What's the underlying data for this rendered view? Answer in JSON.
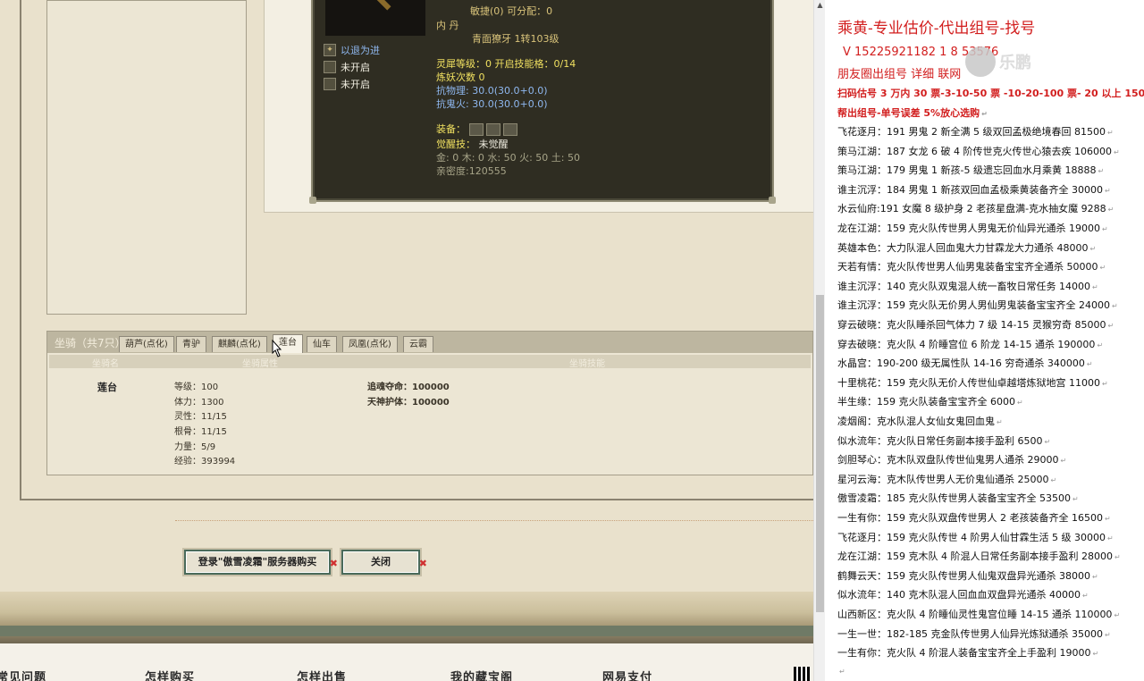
{
  "pet_card": {
    "stat_partial": "敏捷(0)  可分配：0",
    "inner_label": "内  丹",
    "inner_value": "青面獠牙 1转103级",
    "skills": [
      {
        "label": "以退为进"
      },
      {
        "label": "未开启"
      },
      {
        "label": "未开启"
      }
    ],
    "linghe": "灵犀等级：0 开启技能格：0/14",
    "lianyao": "炼妖次数 0",
    "kangwuli": "抗物理: 30.0(30.0+0.0)",
    "kangguihuo": "抗鬼火: 30.0(30.0+0.0)",
    "equip_label": "装备：",
    "juexing_label": "觉醒技：",
    "juexing_value": "未觉醒",
    "elements": "金: 0 木: 0 水: 50 火: 50 土: 50",
    "intimacy": "亲密度:120555"
  },
  "mount": {
    "title": "坐骑（共7只）",
    "tabs": [
      "葫芦(点化)",
      "青驴",
      "麒麟(点化)",
      "莲台",
      "仙车",
      "凤凰(点化)",
      "云霸"
    ],
    "active_tab": 3,
    "columns": [
      "坐骑名",
      "坐骑属性",
      "坐骑技能"
    ],
    "name": "莲台",
    "attributes": [
      "等级：100",
      "体力：1300",
      "灵性：11/15",
      "根骨：11/15",
      "力量：5/9",
      "经验：393994"
    ],
    "skills": [
      "追魂夺命：100000",
      "天神护体：100000"
    ]
  },
  "buttons": {
    "login": "登录\"傲雪凌霜\"服务器购买",
    "close": "关闭"
  },
  "footer": {
    "items": [
      "常见问题",
      "怎样购买",
      "怎样出售",
      "我的藏宝阁",
      "网易支付"
    ]
  },
  "doc": {
    "title": "乘黄-专业估价-代出组号-找号",
    "contact": "V 15225921182  1  8  53576",
    "circle": "朋友圈出组号   详细   联网",
    "promo1": "扫码估号 3 万内 30 票-3-10-50 票  -10-20-100 票- 20 以上 150",
    "promo2": "帮出组号-单号误差 5%放心选购",
    "watermark": "乐鹏",
    "lines": [
      "飞花逐月：191 男鬼 2 新全满 5 级双回孟极绝境春回 81500",
      "策马江湖：187 女龙 6 破 4 阶传世克火传世心猿去疾 106000",
      "策马江湖：179 男鬼 1 新孩-5 级遗忘回血水月乘黄 18888",
      "谁主沉浮：184 男鬼 1 新孩双回血孟极乘黄装备齐全 30000",
      "水云仙府:191 女魔 8 级护身 2 老孩星盘满-克水抽女魔 9288",
      "龙在江湖：159 克火队传世男人男鬼无价仙异光通杀 19000",
      "英雄本色：大力队混人回血鬼大力甘霖龙大力通杀 48000",
      "天若有情：克火队传世男人仙男鬼装备宝宝齐全通杀 50000",
      "谁主沉浮：140 克火队双鬼混人统一畜牧日常任务 14000",
      "谁主沉浮：159 克火队无价男人男仙男鬼装备宝宝齐全 24000",
      "穿云破晓：克火队睡杀回气体力 7 级 14-15 灵猴穷奇 85000",
      "穿去破晓：克火队 4 阶睡宫位 6 阶龙 14-15 通杀 190000",
      "水晶宫：190-200 级无属性队 14-16 穷奇通杀 340000",
      "十里桃花：159 克火队无价人传世仙卓越塔炼狱地宫 11000",
      "半生缘：159 克火队装备宝宝齐全 6000",
      "凌烟阁：克水队混人女仙女鬼回血鬼",
      "似水流年：克火队日常任务副本接手盈利 6500",
      "剑胆琴心：克木队双盘队传世仙鬼男人通杀 29000",
      "星河云海：克木队传世男人无价鬼仙通杀 25000",
      "傲雪凌霜：185 克火队传世男人装备宝宝齐全 53500",
      "一生有你：159 克火队双盘传世男人 2 老孩装备齐全 16500",
      "飞花逐月：159 克火队传世 4 阶男人仙甘霖生活 5 级 30000",
      "龙在江湖：159 克木队 4 阶混人日常任务副本接手盈利 28000",
      "鹤舞云天：159 克火队传世男人仙鬼双盘异光通杀 38000",
      "似水流年：140 克木队混人回血血双盘异光通杀 40000",
      "山西新区：克火队 4 阶睡仙灵性鬼宫位睡 14-15 通杀 110000",
      "一生一世：182-185 克金队传世男人仙异光炼狱通杀 35000",
      "一生有你：克火队 4 阶混人装备宝宝齐全上手盈利 19000",
      ""
    ]
  }
}
